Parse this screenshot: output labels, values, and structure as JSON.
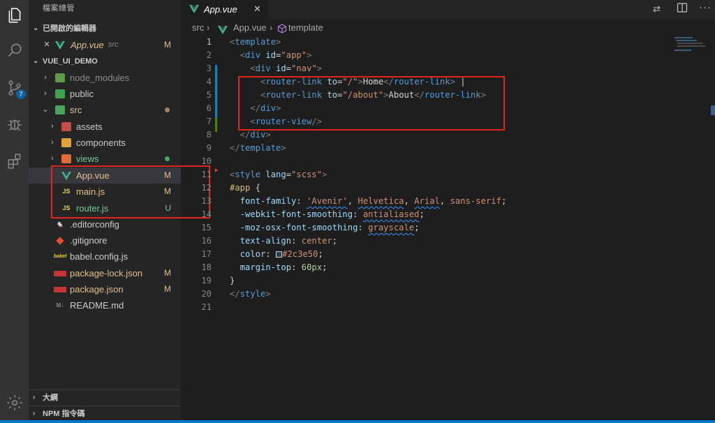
{
  "explorer": {
    "title": "檔案總管",
    "open_editors": {
      "header": "已開啟的編輯器",
      "items": [
        {
          "name": "App.vue",
          "path": "src",
          "status": "M"
        }
      ]
    },
    "project": {
      "header": "VUE_UI_DEMO",
      "items": [
        {
          "name": "node_modules",
          "status": ""
        },
        {
          "name": "public",
          "status": ""
        },
        {
          "name": "src",
          "status": ""
        },
        {
          "name": "assets",
          "status": ""
        },
        {
          "name": "components",
          "status": ""
        },
        {
          "name": "views",
          "status": ""
        },
        {
          "name": "App.vue",
          "status": "M"
        },
        {
          "name": "main.js",
          "status": "M"
        },
        {
          "name": "router.js",
          "status": "U"
        },
        {
          "name": ".editorconfig",
          "status": ""
        },
        {
          "name": ".gitignore",
          "status": ""
        },
        {
          "name": "babel.config.js",
          "status": ""
        },
        {
          "name": "package-lock.json",
          "status": "M"
        },
        {
          "name": "package.json",
          "status": "M"
        },
        {
          "name": "README.md",
          "status": ""
        }
      ]
    },
    "outline_header": "大綱",
    "npm_header": "NPM 指令碼"
  },
  "activity": {
    "scm_badge": "7"
  },
  "editor": {
    "tab_label": "App.vue",
    "breadcrumb": {
      "folder": "src",
      "file": "App.vue",
      "symbol": "template"
    },
    "line_numbers": [
      "1",
      "2",
      "3",
      "4",
      "5",
      "6",
      "7",
      "8",
      "9",
      "10",
      "11",
      "12",
      "13",
      "14",
      "15",
      "16",
      "17",
      "18",
      "19",
      "20",
      "21"
    ]
  },
  "colors": {
    "modified": "#e2c08d",
    "untracked": "#73c991",
    "annotation_box": "#e0251b",
    "accent": "#007acc"
  },
  "icons": [
    "explorer-icon",
    "search-icon",
    "source-control-icon",
    "debug-icon",
    "extensions-icon",
    "manage-gear-icon",
    "vue-file-icon",
    "js-file-icon",
    "split-editor-icon",
    "compare-icon",
    "more-icon"
  ]
}
